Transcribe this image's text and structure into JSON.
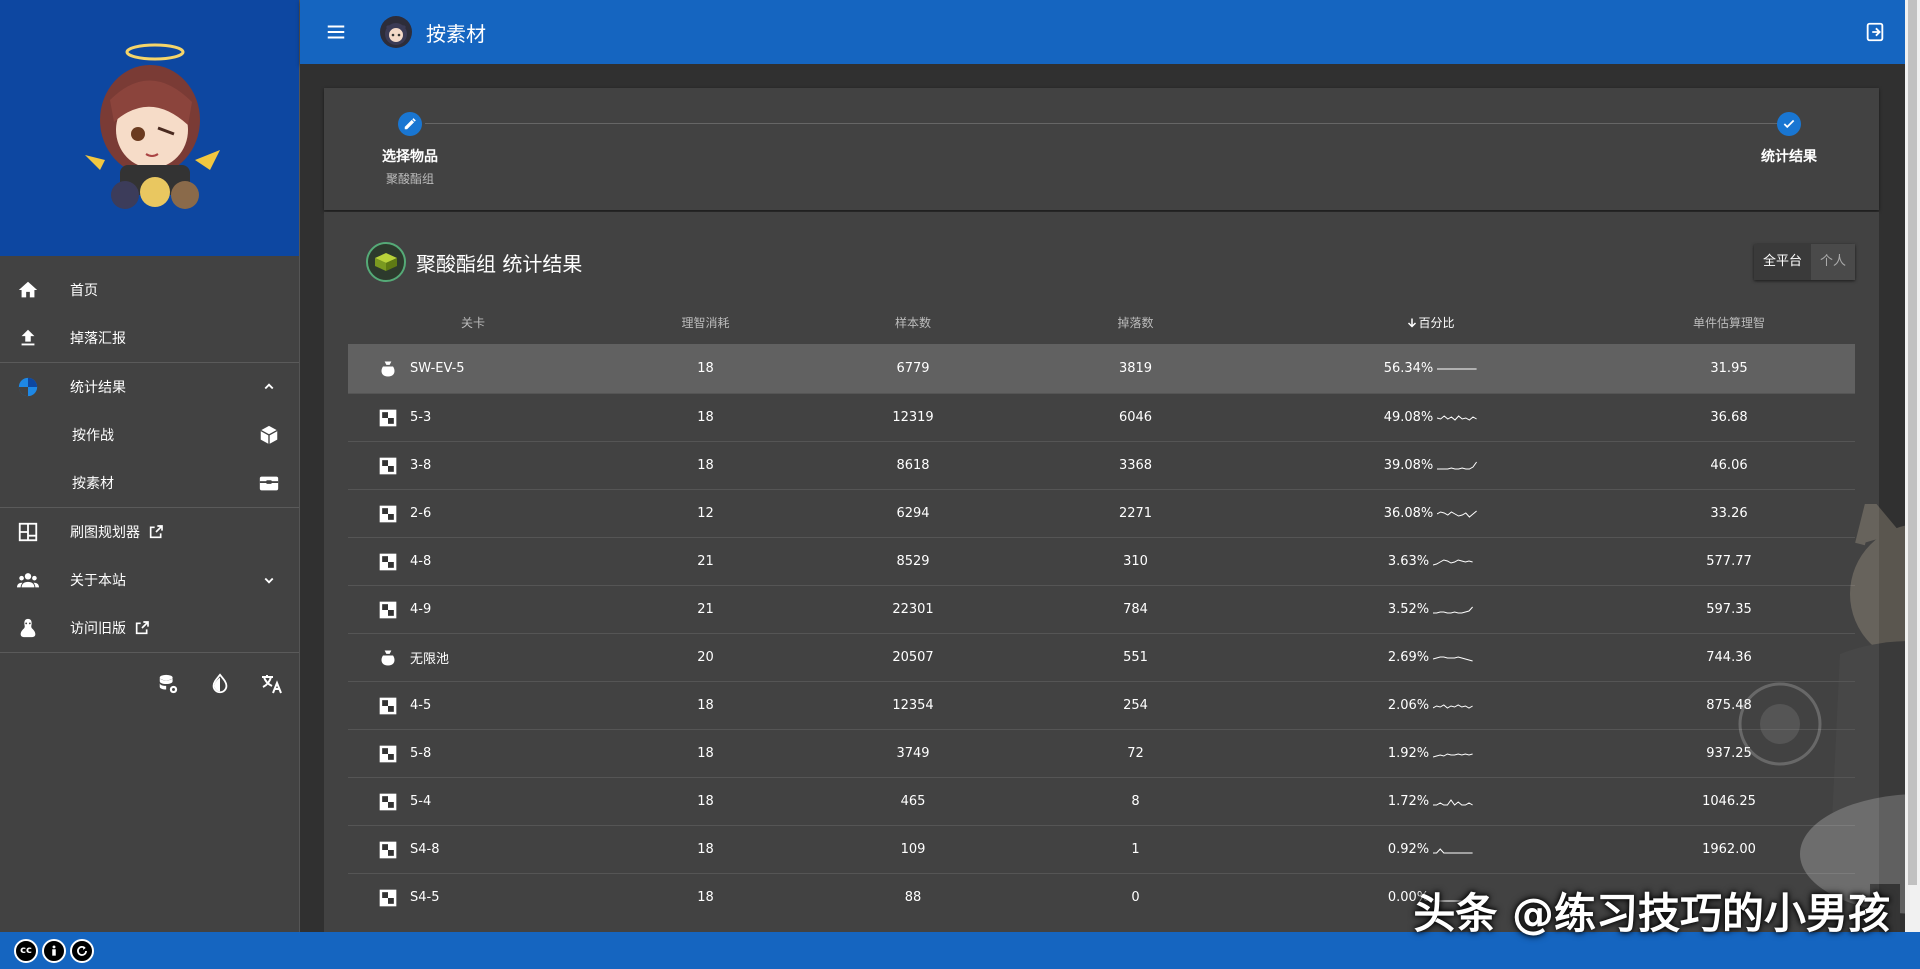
{
  "app": {
    "page_title": "按素材"
  },
  "sidebar": {
    "items": [
      {
        "label": "首页",
        "icon": "home-icon"
      },
      {
        "label": "掉落汇报",
        "icon": "upload-icon"
      },
      {
        "label": "统计结果",
        "icon": "pie-chart-icon",
        "expanded": true
      },
      {
        "label": "按作战",
        "icon": "cube-icon"
      },
      {
        "label": "按素材",
        "icon": "inbox-icon"
      },
      {
        "label": "刷图规划器",
        "icon": "planner-icon",
        "external": true
      },
      {
        "label": "关于本站",
        "icon": "people-icon"
      },
      {
        "label": "访问旧版",
        "icon": "legacy-icon",
        "external": true
      }
    ]
  },
  "stepper": {
    "step1_label": "选择物品",
    "step1_sub": "聚酸酯组",
    "step2_label": "统计结果"
  },
  "card": {
    "title": "聚酸酯组 统计结果",
    "toggle_all": "全平台",
    "toggle_personal": "个人"
  },
  "table": {
    "headers": [
      "关卡",
      "理智消耗",
      "样本数",
      "掉落数",
      "百分比",
      "单件估算理智"
    ],
    "rows": [
      {
        "stage": "SW-EV-5",
        "type": "bag",
        "cost": "18",
        "samples": "6779",
        "drops": "3819",
        "percent": "56.34%",
        "spark": [
          5,
          5,
          5,
          5,
          5,
          5,
          5,
          5,
          5,
          5,
          5,
          5
        ],
        "ap": "31.95"
      },
      {
        "stage": "5-3",
        "type": "grid",
        "cost": "18",
        "samples": "12319",
        "drops": "6046",
        "percent": "49.08%",
        "spark": [
          5,
          6,
          3,
          6,
          4,
          7,
          3,
          6,
          5,
          7,
          4,
          6
        ],
        "ap": "36.68"
      },
      {
        "stage": "3-8",
        "type": "grid",
        "cost": "18",
        "samples": "8618",
        "drops": "3368",
        "percent": "39.08%",
        "spark": [
          8,
          8,
          8,
          8,
          7,
          8,
          8,
          7,
          8,
          8,
          6,
          1
        ],
        "ap": "46.06"
      },
      {
        "stage": "2-6",
        "type": "grid",
        "cost": "12",
        "samples": "6294",
        "drops": "2271",
        "percent": "36.08%",
        "spark": [
          5,
          3,
          4,
          6,
          3,
          5,
          7,
          6,
          4,
          8,
          5,
          2
        ],
        "ap": "33.26"
      },
      {
        "stage": "4-8",
        "type": "grid",
        "cost": "21",
        "samples": "8529",
        "drops": "310",
        "percent": "3.63%",
        "spark": [
          8,
          7,
          5,
          3,
          4,
          6,
          5,
          3,
          4,
          5,
          4,
          5
        ],
        "ap": "577.77"
      },
      {
        "stage": "4-9",
        "type": "grid",
        "cost": "21",
        "samples": "22301",
        "drops": "784",
        "percent": "3.52%",
        "spark": [
          8,
          8,
          7,
          7,
          8,
          8,
          7,
          8,
          8,
          7,
          6,
          2
        ],
        "ap": "597.35"
      },
      {
        "stage": "无限池",
        "type": "bag",
        "cost": "20",
        "samples": "20507",
        "drops": "551",
        "percent": "2.69%",
        "spark": [
          6,
          5,
          4,
          4,
          5,
          5,
          5,
          4,
          5,
          6,
          7,
          8
        ],
        "ap": "744.36"
      },
      {
        "stage": "4-5",
        "type": "grid",
        "cost": "18",
        "samples": "12354",
        "drops": "254",
        "percent": "2.06%",
        "spark": [
          7,
          5,
          6,
          4,
          7,
          5,
          6,
          4,
          6,
          5,
          7,
          5
        ],
        "ap": "875.48"
      },
      {
        "stage": "5-8",
        "type": "grid",
        "cost": "18",
        "samples": "3749",
        "drops": "72",
        "percent": "1.92%",
        "spark": [
          8,
          7,
          6,
          7,
          5,
          6,
          6,
          5,
          6,
          5,
          6,
          5
        ],
        "ap": "937.25"
      },
      {
        "stage": "5-4",
        "type": "grid",
        "cost": "18",
        "samples": "465",
        "drops": "8",
        "percent": "1.72%",
        "spark": [
          8,
          8,
          6,
          8,
          8,
          3,
          8,
          5,
          8,
          8,
          6,
          8
        ],
        "ap": "1046.25"
      },
      {
        "stage": "S4-8",
        "type": "grid",
        "cost": "18",
        "samples": "109",
        "drops": "1",
        "percent": "0.92%",
        "spark": [
          8,
          8,
          4,
          8,
          8,
          8,
          8,
          8,
          8,
          8,
          8,
          8
        ],
        "ap": "1962.00"
      },
      {
        "stage": "S4-5",
        "type": "grid",
        "cost": "18",
        "samples": "88",
        "drops": "0",
        "percent": "0.00%",
        "spark": [
          8,
          8,
          8,
          8,
          8,
          8,
          8,
          8,
          8,
          8,
          8,
          8
        ],
        "ap": ""
      }
    ]
  },
  "watermark": "头条 @练习技巧的小男孩",
  "colors": {
    "primary": "#1565c0",
    "sidebar_hero": "#0d47a1",
    "surface": "#424242",
    "background": "#303030",
    "highlight_row": "#616161"
  }
}
